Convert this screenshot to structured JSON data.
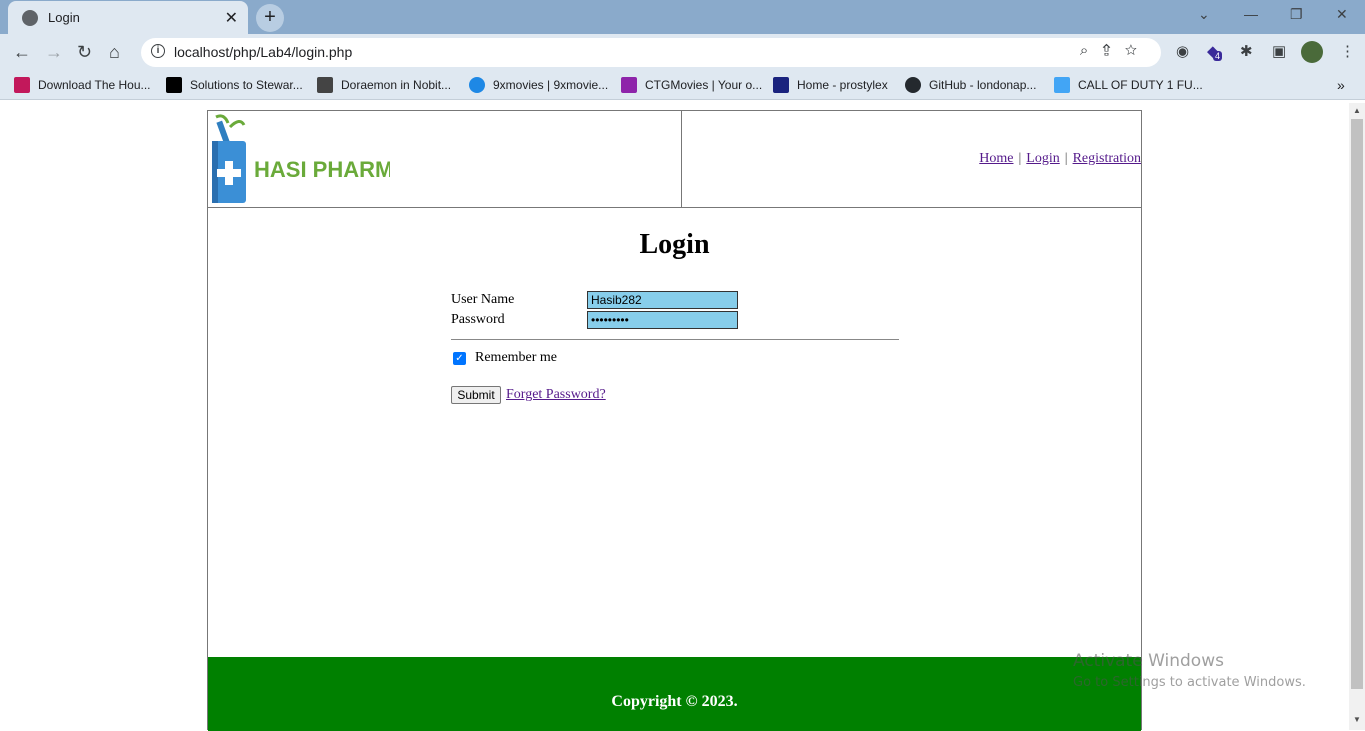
{
  "browser": {
    "tab_title": "Login",
    "tab_close": "✕",
    "new_tab": "+",
    "url": "localhost/php/Lab4/login.php",
    "nav": {
      "back": "←",
      "forward": "→",
      "reload": "↻",
      "home": "⌂"
    },
    "bookmarks": [
      {
        "label": "Download The Hou...",
        "color": "#c2185b"
      },
      {
        "label": "Solutions to Stewar...",
        "color": "#000000"
      },
      {
        "label": "Doraemon in Nobit...",
        "color": "#444444"
      },
      {
        "label": "9xmovies | 9xmovie...",
        "color": "#1e88e5"
      },
      {
        "label": "CTGMovies | Your o...",
        "color": "#8e24aa"
      },
      {
        "label": "Home - prostylex",
        "color": "#1a237e"
      },
      {
        "label": "GitHub - londonap...",
        "color": "#24292e"
      },
      {
        "label": "CALL OF DUTY 1 FU...",
        "color": "#42a5f5"
      }
    ],
    "extension_badge": "4"
  },
  "site": {
    "logo_text": "HASI PHARMA",
    "nav_links": [
      "Home",
      "Login",
      "Registration"
    ],
    "nav_separator": "|"
  },
  "login": {
    "title": "Login",
    "username_label": "User Name",
    "username_value": "Hasib282",
    "password_label": "Password",
    "password_value": "•••••••••",
    "remember_label": "Remember me",
    "remember_checked": true,
    "submit_label": "Submit",
    "forget_label": "Forget Password?"
  },
  "footer": {
    "copyright": "Copyright © 2023."
  },
  "watermark": {
    "line1": "Activate Windows",
    "line2": "Go to Settings to activate Windows."
  },
  "colors": {
    "footer": "#008000",
    "input_bg": "#87ceeb",
    "link": "#551a8b"
  }
}
